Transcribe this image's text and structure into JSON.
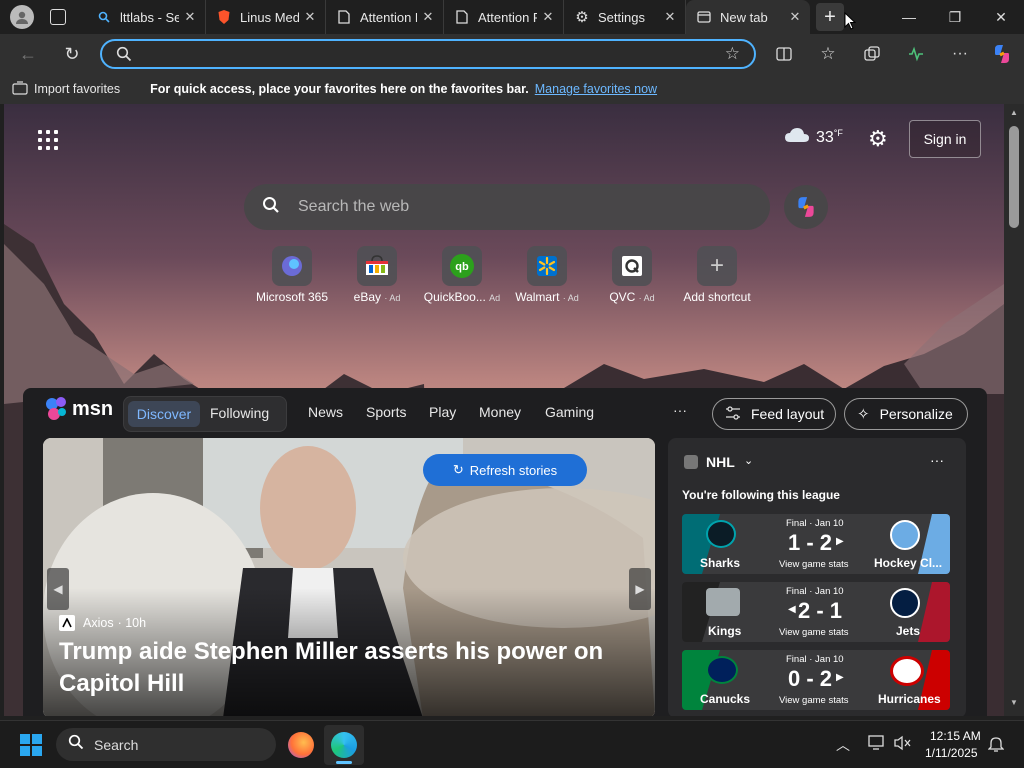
{
  "tabs": [
    {
      "title": "lttlabs - Se",
      "icon": "search-icon"
    },
    {
      "title": "Linus Medi",
      "icon": "brave-icon"
    },
    {
      "title": "Attention F",
      "icon": "page-icon"
    },
    {
      "title": "Attention F",
      "icon": "page-icon"
    },
    {
      "title": "Settings",
      "icon": "gear-icon"
    },
    {
      "title": "New tab",
      "icon": "newtab-icon"
    }
  ],
  "address": {
    "value": ""
  },
  "favorites_bar": {
    "import_label": "Import favorites",
    "message": "For quick access, place your favorites here on the favorites bar.",
    "manage_link": "Manage favorites now"
  },
  "weather": {
    "temp": "33",
    "unit": "°F",
    "icon": "cloud-icon"
  },
  "signin_label": "Sign in",
  "search": {
    "placeholder": "Search the web"
  },
  "shortcuts": [
    {
      "label": "Microsoft 365",
      "ad": "",
      "icon": "m365-icon",
      "color": "#6b6bd6"
    },
    {
      "label": "eBay",
      "ad": "· Ad",
      "icon": "ebay-icon",
      "color": "#e53238"
    },
    {
      "label": "QuickBoo...",
      "ad": "Ad",
      "icon": "quickbooks-icon",
      "color": "#2ca01c"
    },
    {
      "label": "Walmart",
      "ad": "· Ad",
      "icon": "walmart-icon",
      "color": "#0071ce"
    },
    {
      "label": "QVC",
      "ad": "· Ad",
      "icon": "qvc-icon",
      "color": "#ffffff"
    },
    {
      "label": "Add shortcut",
      "ad": "",
      "icon": "plus-icon",
      "color": "#cccccc"
    }
  ],
  "msn": {
    "logo": "msn",
    "toggle": {
      "discover": "Discover",
      "following": "Following"
    },
    "nav": [
      "News",
      "Sports",
      "Play",
      "Money",
      "Gaming"
    ],
    "more": "···",
    "feed_layout": "Feed layout",
    "personalize": "Personalize",
    "refresh": "Refresh stories",
    "story": {
      "source": "Axios",
      "time": "· 10h",
      "headline": "Trump aide Stephen Miller asserts his power on Capitol Hill"
    }
  },
  "nhl": {
    "title": "NHL",
    "subtitle": "You're following this league",
    "more": "···",
    "games": [
      {
        "status": "Final · Jan 10",
        "score": "1 - 2",
        "arrow": "right",
        "home": "Sharks",
        "away": "Hockey Cl...",
        "stats": "View game stats",
        "home_color": "#006d75",
        "away_color": "#6cace4"
      },
      {
        "status": "Final · Jan 10",
        "score": "2 - 1",
        "arrow": "left",
        "home": "Kings",
        "away": "Jets",
        "stats": "View game stats",
        "home_color": "#111111",
        "away_color": "#ac162c"
      },
      {
        "status": "Final · Jan 10",
        "score": "0 - 2",
        "arrow": "right",
        "home": "Canucks",
        "away": "Hurricanes",
        "stats": "View game stats",
        "home_color": "#00843d",
        "away_color": "#cc0000"
      }
    ]
  },
  "taskbar": {
    "search_label": "Search",
    "time": "12:15 AM",
    "date": "1/11/2025"
  }
}
